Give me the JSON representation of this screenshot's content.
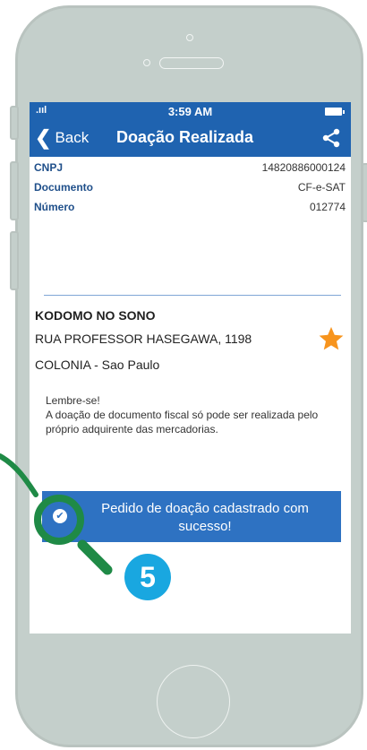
{
  "status_bar": {
    "signal": ".ııl",
    "time": "3:59 AM"
  },
  "nav": {
    "back_label": "Back",
    "title": "Doação Realizada"
  },
  "details": [
    {
      "label": "CNPJ",
      "value": "14820886000124"
    },
    {
      "label": "Documento",
      "value": "CF-e-SAT"
    },
    {
      "label": "Número",
      "value": "012774"
    }
  ],
  "company": {
    "name": "KODOMO NO SONO",
    "address": "RUA PROFESSOR HASEGAWA, 1198",
    "city": "COLONIA - Sao Paulo",
    "favorite_icon": "star-icon"
  },
  "reminder": {
    "title": "Lembre-se!",
    "text": "A doação de documento fiscal só pode ser realizada pelo próprio adquirente das mercadorias."
  },
  "toast": {
    "message": "Pedido de doação cadastrado com sucesso!"
  },
  "annotation": {
    "step": "5"
  },
  "colors": {
    "brand_blue": "#1f63b0",
    "toast_blue": "#2e72c2",
    "star_orange": "#f7941d",
    "magnifier_green": "#1f8a46",
    "badge_blue": "#19a7e0"
  }
}
